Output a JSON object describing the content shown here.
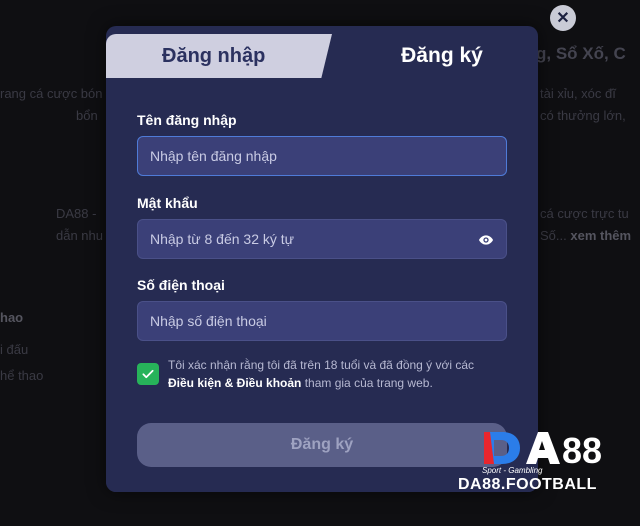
{
  "background": {
    "frag1": "g, Sổ Xố, C",
    "frag2": "rang cá cược bón",
    "frag3": "tài xỉu, xóc đĩ",
    "frag4": "bổn",
    "frag5": "có thưởng lớn,",
    "frag6": "DA88 -",
    "frag7": "cá cược trực tu",
    "frag8": "dẫn nhu",
    "frag9": "Số...",
    "frag9_more": "xem thêm",
    "frag10": "hao",
    "frag11": "i đấu",
    "frag12": "hể thao"
  },
  "tabs": {
    "login": "Đăng nhập",
    "register": "Đăng ký"
  },
  "form": {
    "username": {
      "label": "Tên đăng nhập",
      "placeholder": "Nhập tên đăng nhập"
    },
    "password": {
      "label": "Mật khẩu",
      "placeholder": "Nhập từ 8 đến 32 ký tự"
    },
    "phone": {
      "label": "Số điện thoại",
      "placeholder": "Nhập số điện thoại"
    },
    "consent": {
      "checked": true,
      "text_before": "Tôi xác nhận rằng tôi đã trên 18 tuổi và đã đồng ý với các",
      "link": "Điều kiện & Điều khoản",
      "text_after": "tham gia của trang web."
    },
    "submit_label": "Đăng ký"
  },
  "close_label": "✕",
  "watermark": {
    "logo": "DA88",
    "tagline": "Sport - Gambling",
    "domain": "DA88.FOOTBALL"
  },
  "colors": {
    "modal_bg": "#262b52",
    "input_bg": "#3b4078",
    "focus_border": "#4f7bd8",
    "checkbox": "#27b35a",
    "submit_bg": "#5a5f88",
    "logo_red": "#e8262d",
    "logo_blue": "#2b7de9"
  }
}
